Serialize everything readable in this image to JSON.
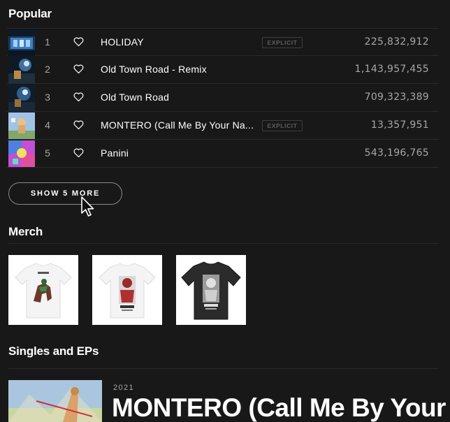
{
  "popular": {
    "title": "Popular",
    "tracks": [
      {
        "num": "1",
        "title": "HOLIDAY",
        "explicit": "EXPLICIT",
        "plays": "225,832,912"
      },
      {
        "num": "2",
        "title": "Old Town Road - Remix",
        "explicit": "",
        "plays": "1,143,957,455"
      },
      {
        "num": "3",
        "title": "Old Town Road",
        "explicit": "",
        "plays": "709,323,389"
      },
      {
        "num": "4",
        "title": "MONTERO (Call Me By Your Na...",
        "explicit": "EXPLICIT",
        "plays": "13,357,951"
      },
      {
        "num": "5",
        "title": "Panini",
        "explicit": "",
        "plays": "543,196,765"
      }
    ],
    "show_more_label": "SHOW 5 MORE"
  },
  "merch": {
    "title": "Merch",
    "items": [
      {
        "icon": "tshirt-white-horse"
      },
      {
        "icon": "tshirt-white-portrait"
      },
      {
        "icon": "tshirt-black-portrait"
      }
    ]
  },
  "singles": {
    "title": "Singles and EPs",
    "items": [
      {
        "year": "2021",
        "title": "MONTERO (Call Me By Your N"
      }
    ]
  },
  "icons": {
    "heart": "heart-outline-icon",
    "cursor": "mouse-pointer-icon"
  },
  "colors": {
    "background": "#181818",
    "text_primary": "#ffffff",
    "text_secondary": "#a7a7a7",
    "divider": "#282828"
  }
}
